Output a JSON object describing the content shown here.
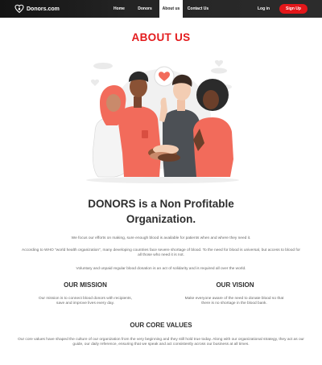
{
  "nav": {
    "brand": "Donors.com",
    "links": [
      "Home",
      "Donors",
      "About us",
      "Contact Us"
    ],
    "active": "About us",
    "login_label": "Log in",
    "signup_label": "Sign Up"
  },
  "page": {
    "title": "ABOUT US",
    "org_heading": "DONORS is a Non Profitable Organization.",
    "intro_paragraphs": [
      "We focus our efforts on making, sure enough blood is available for patients when and where they need it.",
      "According to WHO \"world health organization\", many developing countries face severe shortage of blood. To the need for blood is universal, but access to blood for all those who need it is not.",
      "Voluntary and unpaid regular blood donation is an act of solidarity and is required all over the world."
    ],
    "mission": {
      "title": "OUR MISSION",
      "text": "Our mission is to connect blood donors with recipients, save and improve lives every day."
    },
    "vision": {
      "title": "OUR VISION",
      "text": "Make everyone aware of the need to donate blood so that there is no shortage in the blood bank."
    },
    "core_values": {
      "title": "OUR CORE VALUES",
      "text": "Our core values have shaped the culture of our organization from the very beginning and they still hold true today. Along with our organizational strategy, they act as our guide, our daily reference, ensuring that we speak and act consistently across our business at all times."
    }
  },
  "colors": {
    "accent": "#e31b1d",
    "navbar": "#1c1c1c",
    "illustration_primary": "#f26b5b"
  }
}
